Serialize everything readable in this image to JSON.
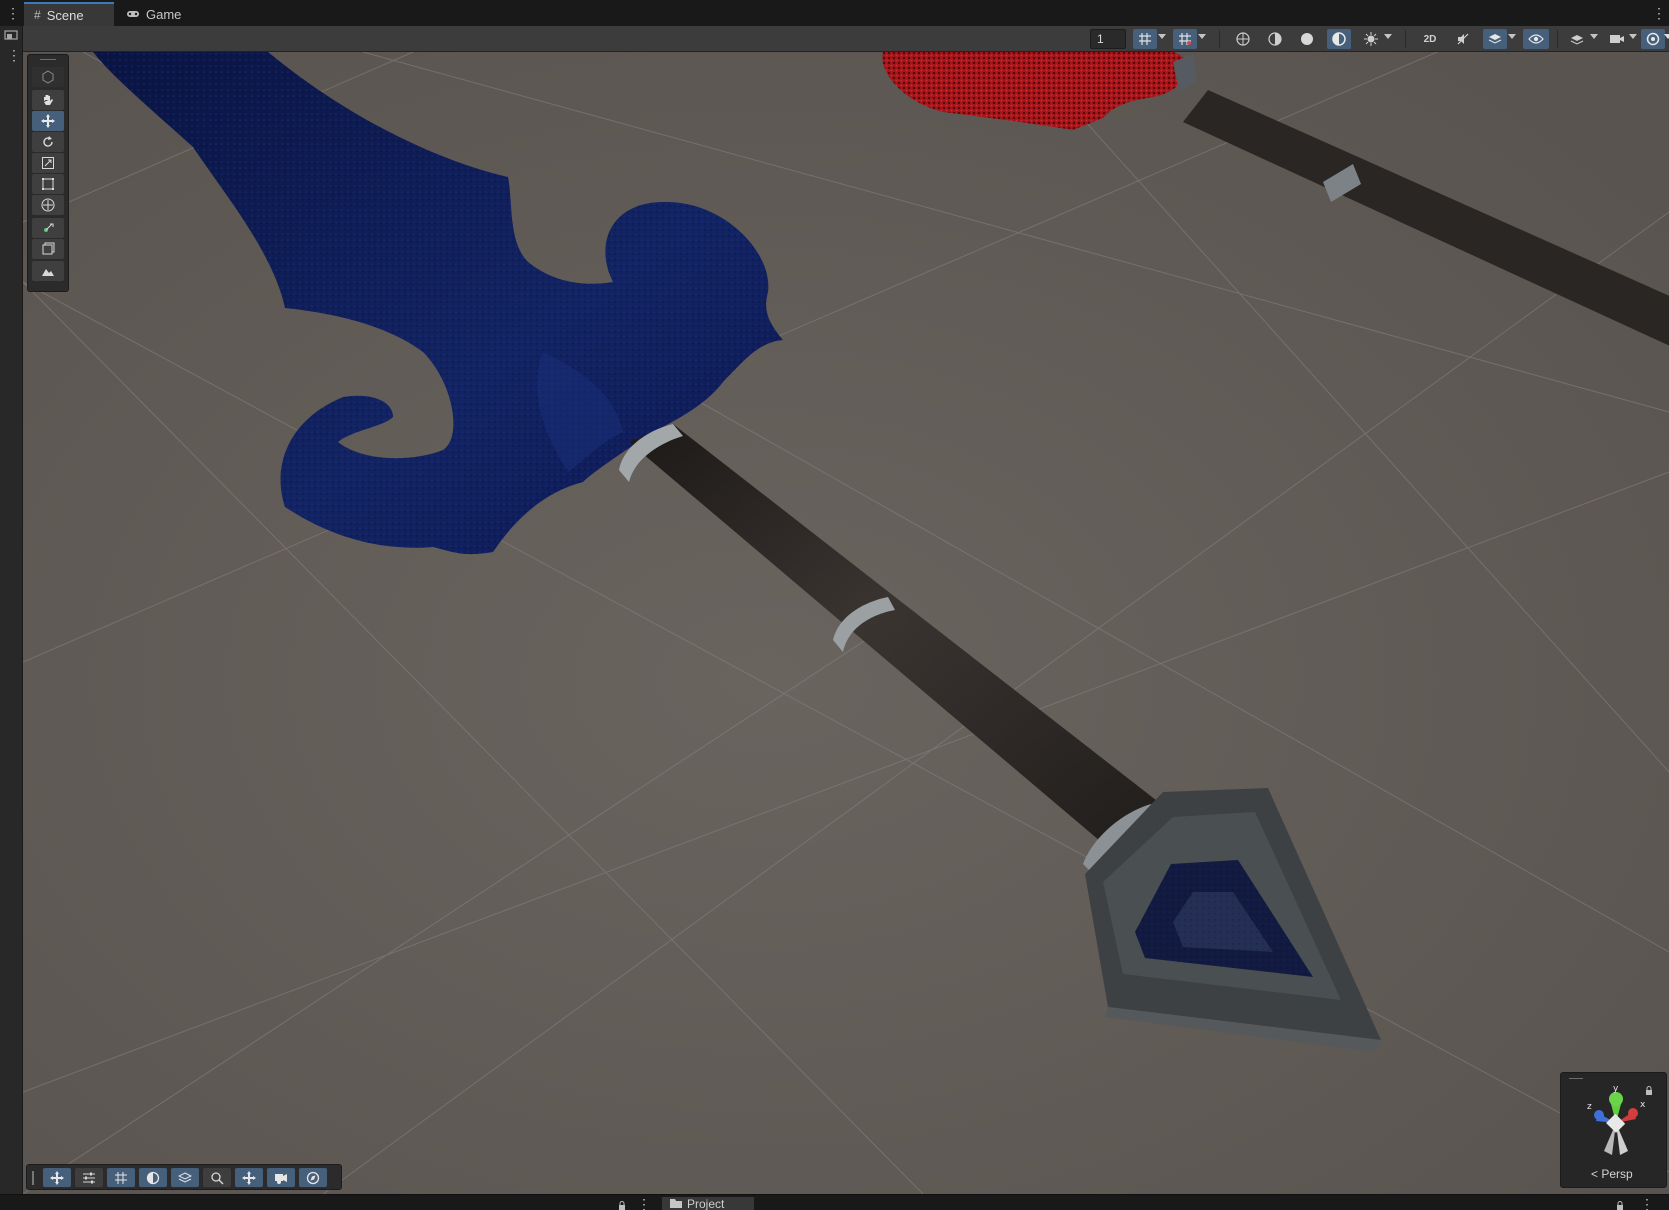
{
  "tabs": [
    {
      "label": "Scene",
      "icon": "hash-icon",
      "active": true
    },
    {
      "label": "Game",
      "icon": "gamepad-icon",
      "active": false
    }
  ],
  "scene_toolbar": {
    "layer_count": "1",
    "buttons": [
      "grid-snapping-icon",
      "grid-visibility-icon",
      "global-view-icon",
      "shaded-sphere-icon",
      "unlit-sphere-icon",
      "lighting-icon",
      "effects-icon",
      "2d-toggle-icon",
      "audio-toggle-icon",
      "layers-icon",
      "visibility-icon",
      "layer-visibility-icon",
      "camera-icon",
      "gizmos-icon"
    ]
  },
  "tool_palette": [
    "view-tool-icon",
    "move-tool-icon",
    "rotate-tool-icon",
    "scale-tool-icon",
    "rect-tool-icon",
    "transform-tool-icon",
    "custom-tool-icon",
    "component-tool-icon",
    "terrain-tool-icon"
  ],
  "bottom_overlay": [
    "move-icon",
    "sliders-icon",
    "grid-icon",
    "shading-icon",
    "layers-icon",
    "search-icon",
    "pivot-icon",
    "camera-icon",
    "compass-icon"
  ],
  "gizmo": {
    "projection_label": "Persp",
    "axes": [
      "x",
      "y",
      "z"
    ]
  },
  "bottom_panel": {
    "tab_label": "Project"
  },
  "colors": {
    "accent": "#3a79bb",
    "active_button": "#46607c",
    "viewport_bg": "#625c57",
    "blade_blue": "#0f1d5a",
    "blade_red": "#b01e22",
    "handle": "#2c2826",
    "ring": "#8f9598"
  }
}
